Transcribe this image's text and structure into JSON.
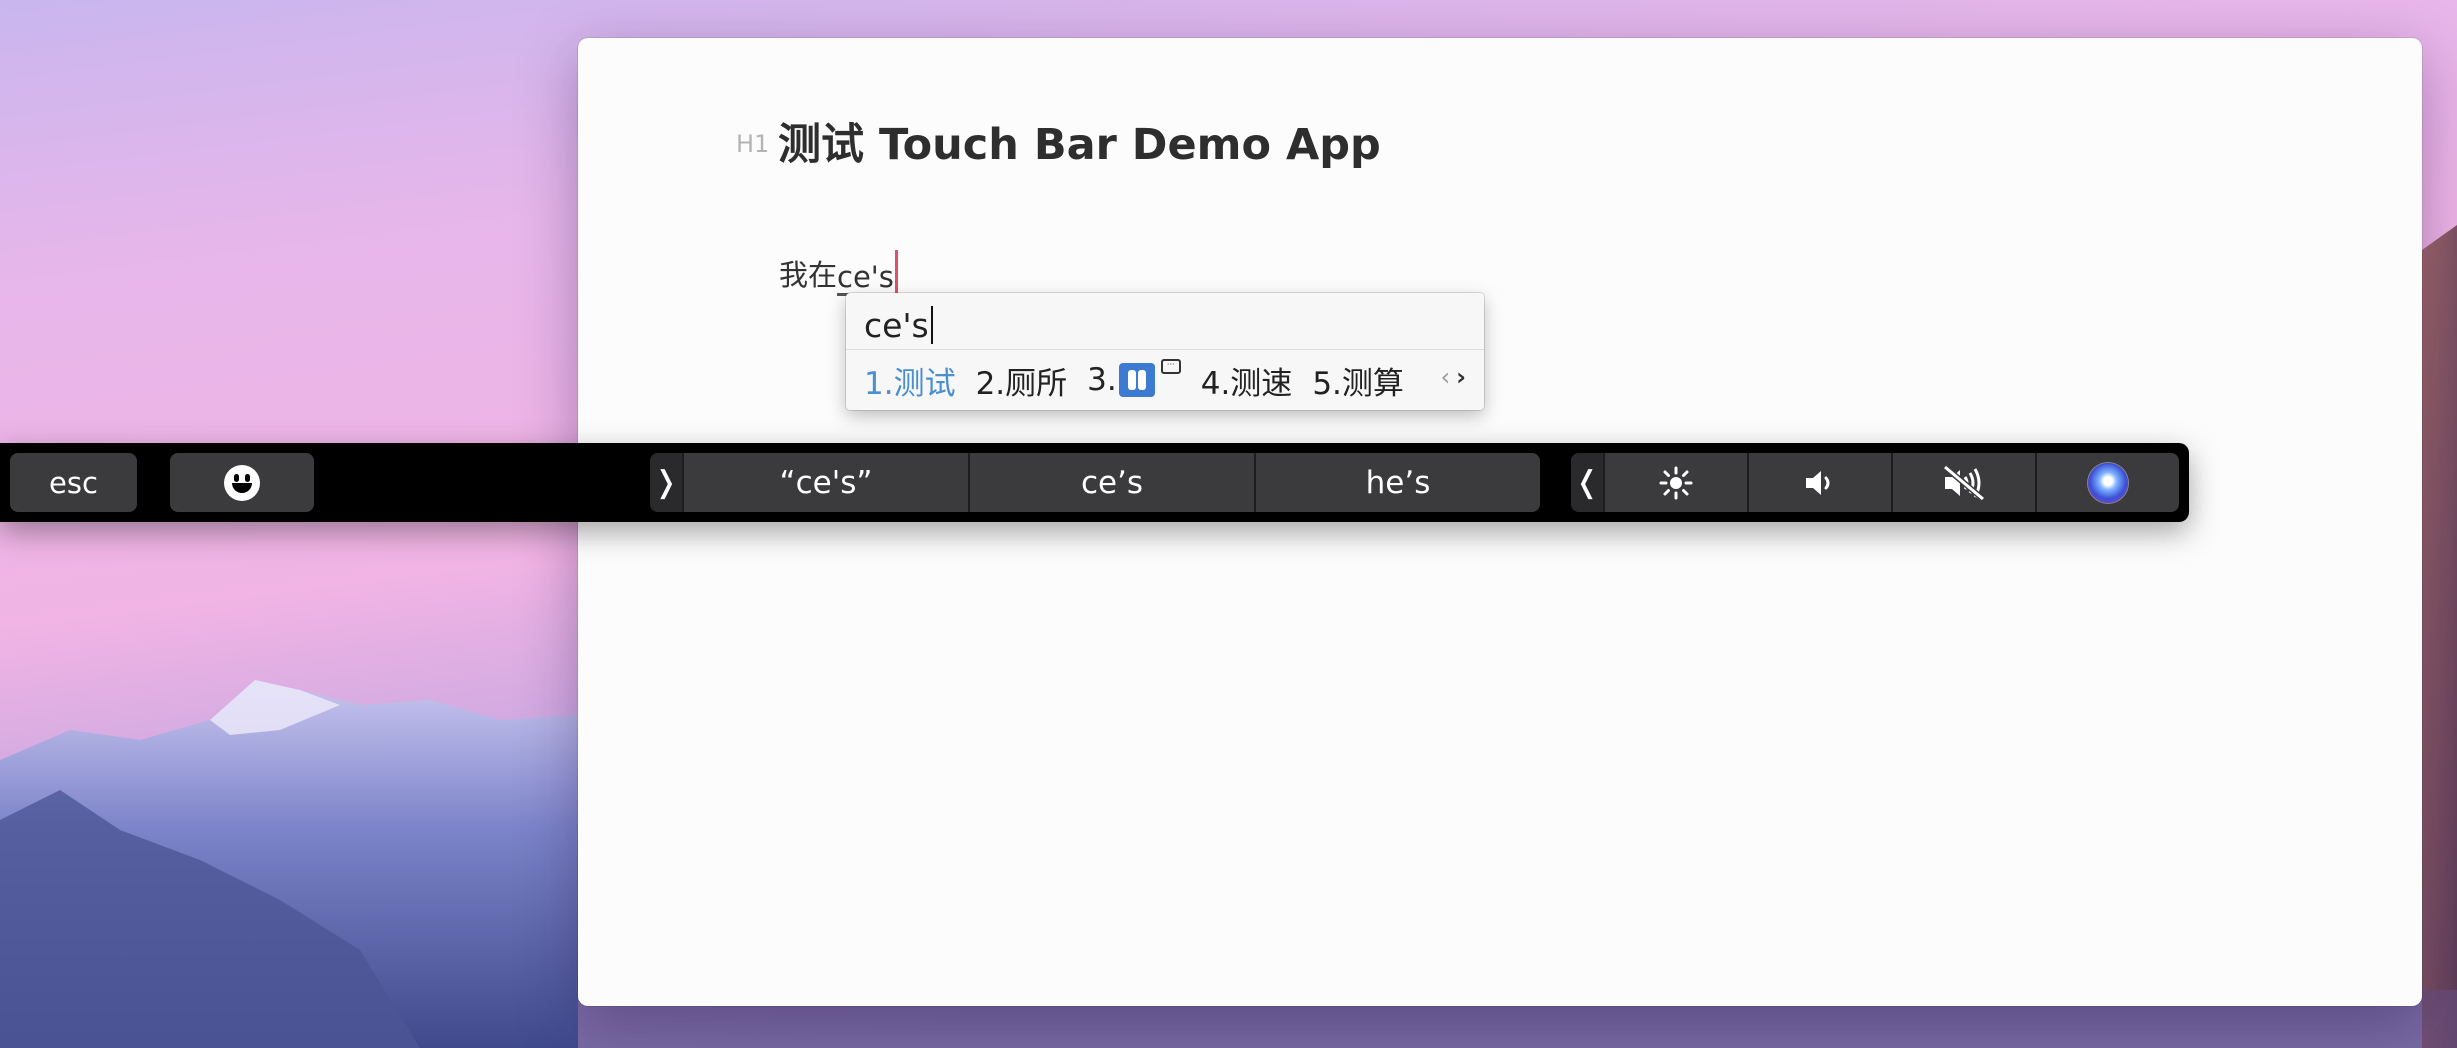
{
  "editor": {
    "heading_badge": "H1",
    "heading": "测试 Touch Bar Demo App",
    "paragraph_committed": "我在",
    "paragraph_marked": "ce's"
  },
  "ime": {
    "composition": "ce's",
    "candidates": [
      {
        "label": "1.测试",
        "selected": true
      },
      {
        "label": "2.厕所",
        "selected": false
      },
      {
        "label": "3.",
        "emoji": "restroom-emoji",
        "selected": false
      },
      {
        "label": "4.测速",
        "selected": false
      },
      {
        "label": "5.测算",
        "selected": false
      }
    ],
    "prev_arrow": "‹",
    "next_arrow": "›"
  },
  "touchbar": {
    "esc_label": "esc",
    "emoji_icon": "smiley-icon",
    "expand_chevron": "❭",
    "collapse_chevron": "❬",
    "suggestions": [
      "“ce's”",
      "ce’s",
      "he’s"
    ],
    "controls": [
      "brightness-icon",
      "volume-icon",
      "mute-icon",
      "siri-icon"
    ]
  },
  "colors": {
    "selected_candidate": "#4a8fd0",
    "caret": "#e0506a",
    "touchbar_key": "#3b3b3d"
  }
}
